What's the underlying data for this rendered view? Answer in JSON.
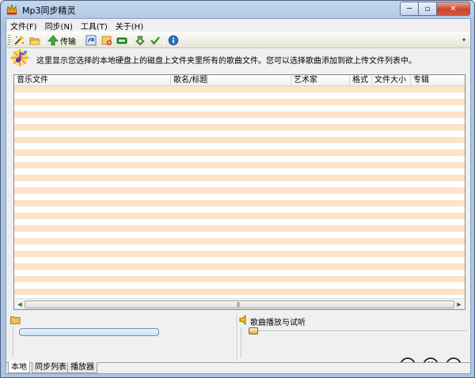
{
  "window": {
    "title": "Mp3同步精灵"
  },
  "menu": [
    {
      "label": "文件(F)"
    },
    {
      "label": "同步(N)"
    },
    {
      "label": "工具(T)"
    },
    {
      "label": "关于(H)"
    }
  ],
  "toolbar": {
    "transfer_label": "传输",
    "icons": [
      "wizard-icon",
      "open-folder-icon",
      "transfer-icon",
      "refresh-icon",
      "add-song-icon",
      "device-icon",
      "settings-icon",
      "check-icon",
      "info-icon"
    ]
  },
  "hint": {
    "text": "这里显示您选择的本地硬盘上的磁盘上文件夹里所有的歌曲文件。您可以选择歌曲添加到欲上传文件列表中。"
  },
  "file_list": {
    "columns": [
      "音乐文件",
      "歌名/标题",
      "艺术家",
      "格式",
      "文件大小",
      "专辑"
    ],
    "rows": []
  },
  "progress": {
    "value": 0
  },
  "player": {
    "label": "歌曲播放与试听",
    "position": 0
  },
  "tabs": [
    {
      "label": "本地",
      "active": true
    },
    {
      "label": "同步列表",
      "active": false
    },
    {
      "label": "播放器",
      "active": false
    }
  ],
  "colors": {
    "row_stripe": "#fde3c8",
    "progress_fill": "#c9e2f3"
  }
}
